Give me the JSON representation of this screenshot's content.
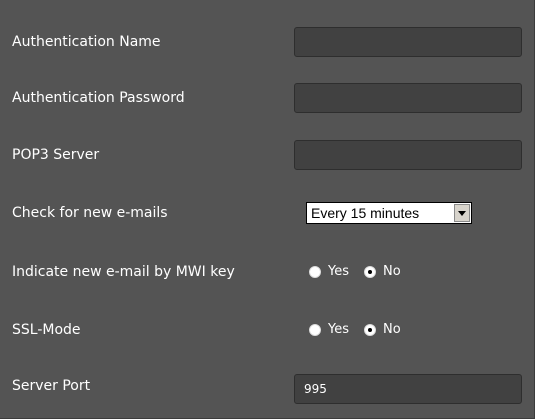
{
  "form": {
    "auth_name": {
      "label": "Authentication Name",
      "value": ""
    },
    "auth_password": {
      "label": "Authentication Password",
      "value": ""
    },
    "pop3_server": {
      "label": "POP3 Server",
      "value": ""
    },
    "check_interval": {
      "label": "Check for new e-mails",
      "selected": "Every 15 minutes"
    },
    "mwi": {
      "label": "Indicate new e-mail by MWI key",
      "yes": "Yes",
      "no": "No",
      "selected": "No"
    },
    "ssl_mode": {
      "label": "SSL-Mode",
      "yes": "Yes",
      "no": "No",
      "selected": "No"
    },
    "server_port": {
      "label": "Server Port",
      "value": "995"
    }
  },
  "colors": {
    "panel_bg": "#545454",
    "field_bg": "#414141",
    "text": "#ffffff"
  },
  "icons": {
    "dropdown": "chevron-down-icon",
    "radio": "radio-icon"
  }
}
